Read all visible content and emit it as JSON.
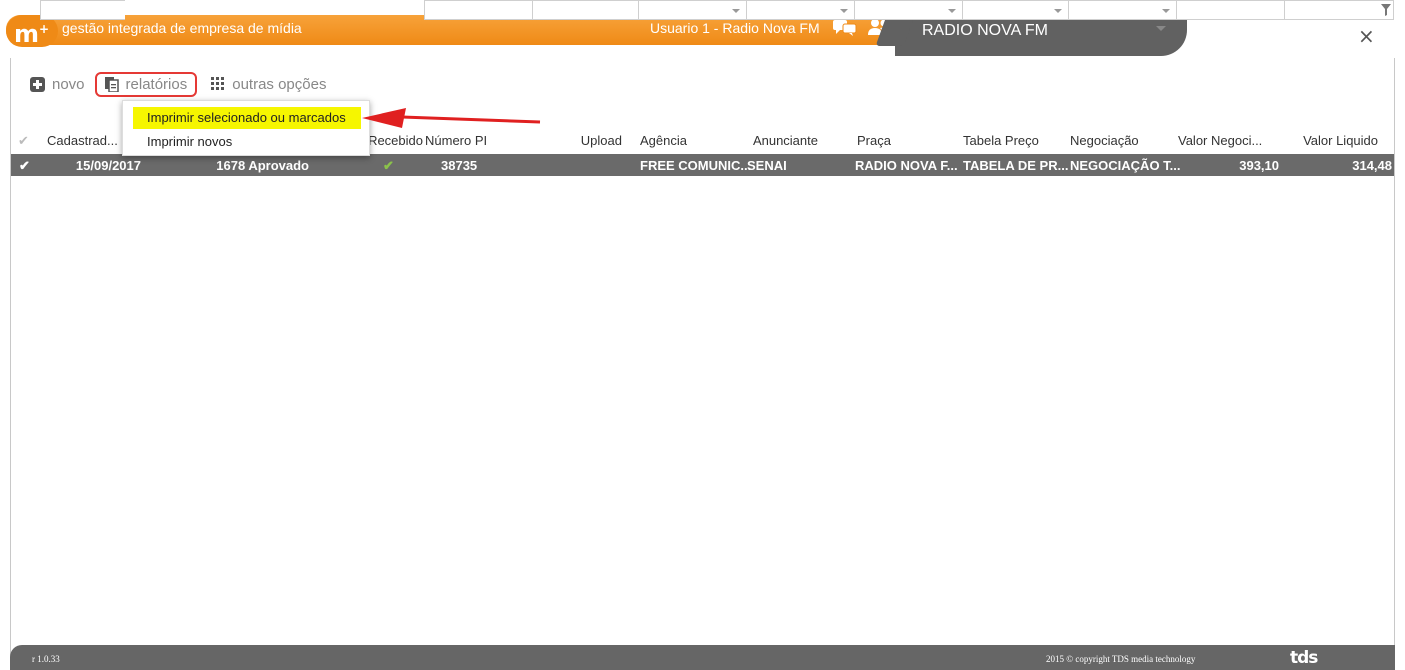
{
  "header": {
    "logo_text": "m",
    "logo_sup": "+",
    "app_title": "gestão integrada de empresa de mídia",
    "user_label": "Usuario 1 - Radio Nova FM",
    "station_name": "RADIO NOVA FM",
    "close_label": "×",
    "accent_color": "#ef8a16"
  },
  "toolbar": {
    "new_label": "novo",
    "reports_label": "relatórios",
    "more_label": "outras opções"
  },
  "reports_menu": {
    "items": [
      "Imprimir selecionado ou marcados",
      "Imprimir novos"
    ]
  },
  "grid": {
    "columns": [
      "Cadastrad...",
      "Recebido",
      "Número PI",
      "Upload",
      "Agência",
      "Anunciante",
      "Praça",
      "Tabela Preço",
      "Negociação",
      "Valor Negoci...",
      "Valor Liquido"
    ],
    "rows": [
      {
        "date": "15/09/2017",
        "status": "1678 Aprovado",
        "received": "✔",
        "pi_number": "38735",
        "upload": "",
        "agency": "FREE COMUNIC...",
        "advertiser": "SENAI",
        "market": "RADIO NOVA F...",
        "price_table": "TABELA DE PR...",
        "negotiation": "NEGOCIAÇÃO T...",
        "negotiated_value": "393,10",
        "net_value": "314,48"
      }
    ]
  },
  "footer": {
    "version": "r 1.0.33",
    "copyright": "2015 © copyright TDS media technology",
    "brand": "tds"
  }
}
